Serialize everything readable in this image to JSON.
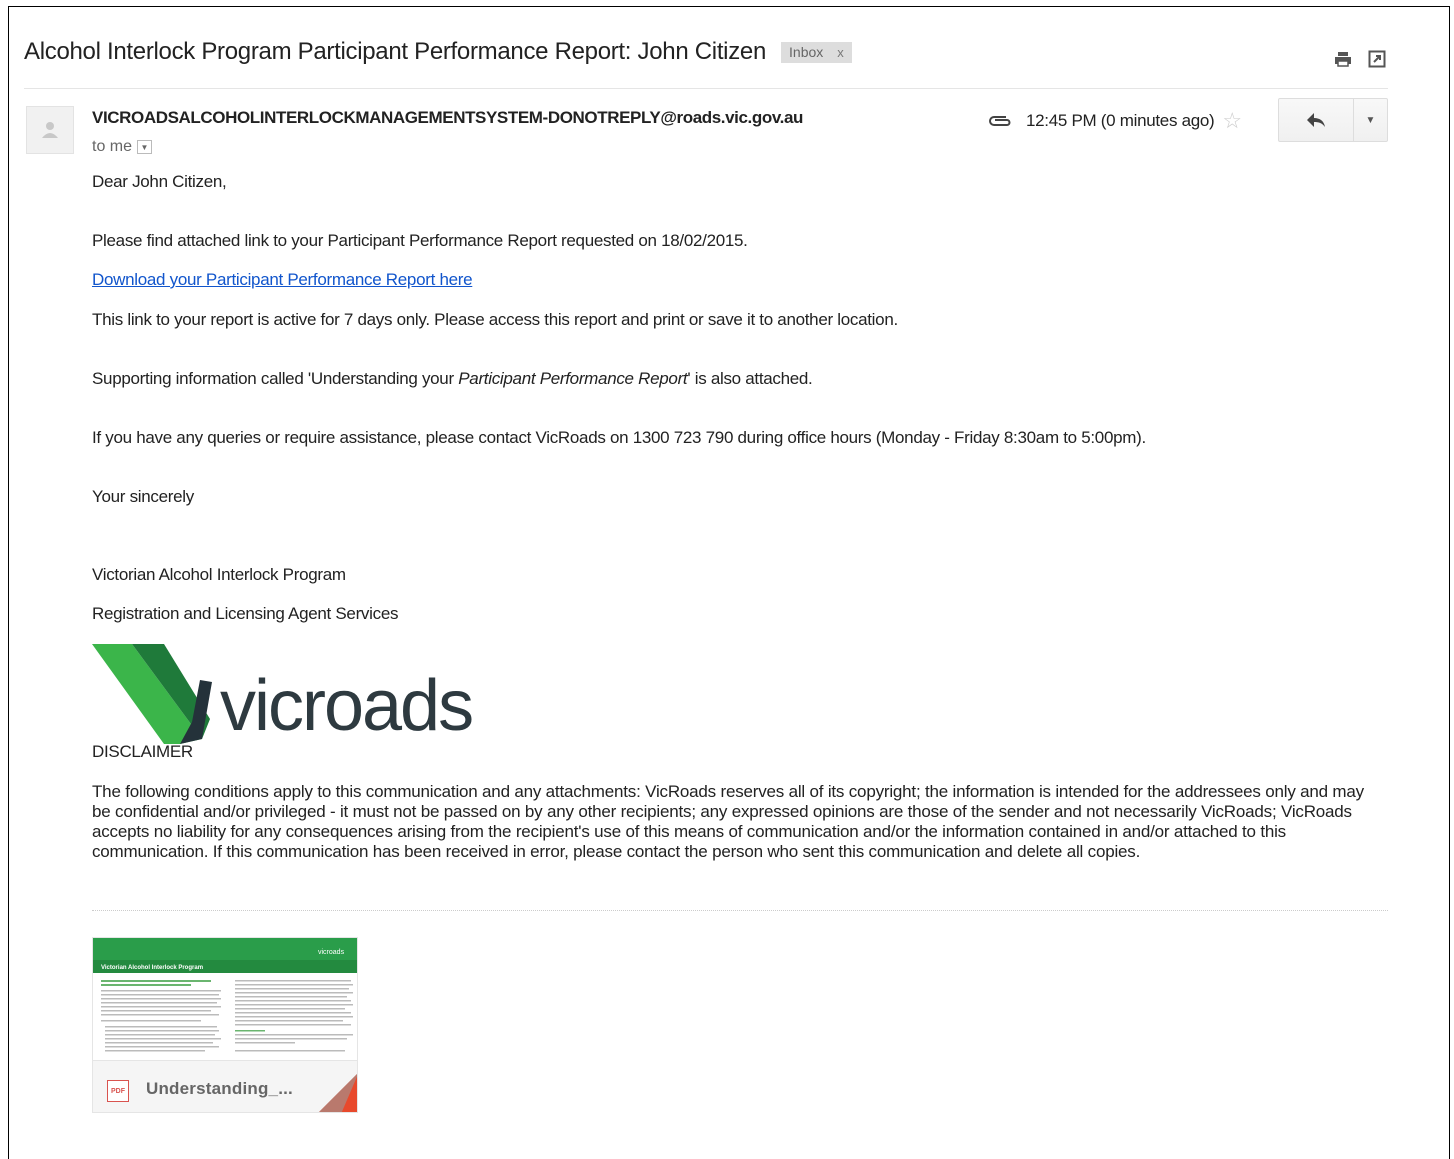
{
  "email": {
    "subject": "Alcohol Interlock Program Participant Performance Report: John Citizen",
    "label": "Inbox",
    "label_close": "x",
    "sender": "VICROADSALCOHOLINTERLOCKMANAGEMENTSYSTEM-DONOTREPLY@roads.vic.gov.au",
    "to": "to me",
    "time": "12:45 PM (0 minutes ago)"
  },
  "body": {
    "greeting": "Dear John Citizen,",
    "p1": "Please find attached link to your Participant Performance Report requested on 18/02/2015.",
    "link": "Download your Participant Performance Report here",
    "p2": "This link to your report is active for 7 days only. Please access this report and print or save it to another location.",
    "p3_before": "Supporting information called 'Understanding your ",
    "p3_em": "Participant Performance Report",
    "p3_after": "' is also attached.",
    "p4": "If you have any queries or require assistance, please contact VicRoads on 1300 723 790 during office hours (Monday - Friday 8:30am to 5:00pm).",
    "closing": "Your sincerely",
    "sig1": "Victorian Alcohol Interlock Program",
    "sig2": "Registration and Licensing Agent Services",
    "logo_text": "vicroads",
    "disclaimer_title": "DISCLAIMER",
    "disclaimer": "The following conditions apply to this communication and any attachments: VicRoads reserves all of its copyright; the information is intended for the addressees only and may be confidential and/or privileged - it must not be passed on by any other recipients; any expressed opinions are those of the sender and not necessarily VicRoads; VicRoads accepts no liability for any consequences arising from the recipient's use of this means of communication and/or the information contained in and/or attached to this communication. If this communication has been received in error, please contact the person who sent this communication and delete all copies."
  },
  "attachment": {
    "name": "Understanding_...",
    "type": "PDF",
    "thumb_header": "Victorian Alcohol Interlock Program",
    "thumb_logo": "vicroads"
  },
  "icons": {
    "print": "print-icon",
    "popout": "new-window-icon",
    "attachment": "paperclip-icon",
    "star": "star-icon",
    "reply": "reply-icon",
    "more": "chevron-down-icon"
  },
  "colors": {
    "link": "#1155cc",
    "brand_green": "#2a9d4a",
    "brand_dark": "#2e3a40"
  }
}
